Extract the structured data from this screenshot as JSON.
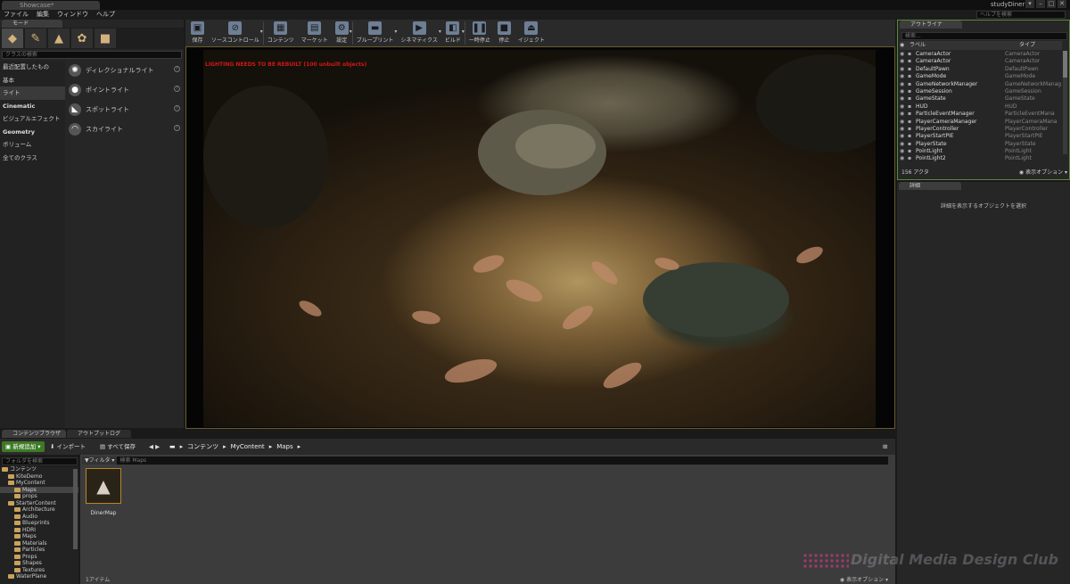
{
  "app": {
    "doc_tab": "Showcase*",
    "project_name": "studyDiner",
    "help_search_placeholder": "ヘルプを検索",
    "window_controls": [
      "▾",
      "–",
      "□",
      "✕"
    ]
  },
  "menu": [
    "ファイル",
    "編集",
    "ウィンドウ",
    "ヘルプ"
  ],
  "modes": {
    "tab": "モード",
    "icons": [
      "place-icon",
      "paint-icon",
      "landscape-icon",
      "foliage-icon",
      "geometry-icon"
    ],
    "search_placeholder": "クラスの検索",
    "categories": [
      {
        "label": "最近配置したもの",
        "selected": false,
        "head": false
      },
      {
        "label": "基本",
        "selected": false,
        "head": false
      },
      {
        "label": "ライト",
        "selected": true,
        "head": false
      },
      {
        "label": "Cinematic",
        "selected": false,
        "head": true
      },
      {
        "label": "ビジュアルエフェクト",
        "selected": false,
        "head": false
      },
      {
        "label": "Geometry",
        "selected": false,
        "head": true
      },
      {
        "label": "ボリューム",
        "selected": false,
        "head": false
      },
      {
        "label": "全てのクラス",
        "selected": false,
        "head": false
      }
    ],
    "items": [
      {
        "label": "ディレクショナルライト",
        "icon": "directional-light-icon",
        "glyph": "✺"
      },
      {
        "label": "ポイントライト",
        "icon": "point-light-icon",
        "glyph": "●"
      },
      {
        "label": "スポットライト",
        "icon": "spot-light-icon",
        "glyph": "◣"
      },
      {
        "label": "スカイライト",
        "icon": "sky-light-icon",
        "glyph": "◠"
      }
    ]
  },
  "toolbar": {
    "buttons": [
      {
        "label": "保存",
        "icon": "save-icon",
        "glyph": "▣",
        "dropdown": false
      },
      {
        "label": "ソースコントロール",
        "icon": "source-control-icon",
        "glyph": "⊘",
        "dropdown": true
      },
      {
        "label": "コンテンツ",
        "icon": "content-icon",
        "glyph": "▦",
        "dropdown": false
      },
      {
        "label": "マーケット",
        "icon": "marketplace-icon",
        "glyph": "▤",
        "dropdown": false
      },
      {
        "label": "設定",
        "icon": "settings-icon",
        "glyph": "⚙",
        "dropdown": true
      },
      {
        "label": "ブループリント",
        "icon": "blueprint-icon",
        "glyph": "▬",
        "dropdown": true
      },
      {
        "label": "シネマティクス",
        "icon": "cinematics-icon",
        "glyph": "▶",
        "dropdown": true
      },
      {
        "label": "ビルド",
        "icon": "build-icon",
        "glyph": "◧",
        "dropdown": true
      },
      {
        "label": "一時停止",
        "icon": "pause-icon",
        "glyph": "❚❚",
        "dropdown": false
      },
      {
        "label": "停止",
        "icon": "stop-icon",
        "glyph": "■",
        "dropdown": false
      },
      {
        "label": "イジェクト",
        "icon": "eject-icon",
        "glyph": "⏏",
        "dropdown": false
      }
    ]
  },
  "viewport": {
    "warning": "LIGHTING NEEDS TO BE REBUILT (100 unbuilt objects)"
  },
  "outliner": {
    "tab": "アウトライナ",
    "search_placeholder": "検索...",
    "col_label": "ラベル",
    "col_type": "タイプ",
    "rows": [
      {
        "name": "CameraActor",
        "type": "CameraActor"
      },
      {
        "name": "CameraActor",
        "type": "CameraActor"
      },
      {
        "name": "DefaultPawn",
        "type": "DefaultPawn"
      },
      {
        "name": "GameMode",
        "type": "GameMode"
      },
      {
        "name": "GameNetworkManager",
        "type": "GameNetworkManag"
      },
      {
        "name": "GameSession",
        "type": "GameSession"
      },
      {
        "name": "GameState",
        "type": "GameState"
      },
      {
        "name": "HUD",
        "type": "HUD"
      },
      {
        "name": "ParticleEventManager",
        "type": "ParticleEventMana"
      },
      {
        "name": "PlayerCameraManager",
        "type": "PlayerCameraMana"
      },
      {
        "name": "PlayerController",
        "type": "PlayerController"
      },
      {
        "name": "PlayerStartPIE",
        "type": "PlayerStartPIE"
      },
      {
        "name": "PlayerState",
        "type": "PlayerState"
      },
      {
        "name": "PointLight",
        "type": "PointLight"
      },
      {
        "name": "PointLight2",
        "type": "PointLight"
      }
    ],
    "actor_count": "156 アクタ",
    "view_options": "表示オプション"
  },
  "details": {
    "tab": "詳細",
    "message": "詳細を表示するオブジェクトを選択"
  },
  "content_browser": {
    "tabs": [
      "コンテンツブラウザ",
      "アウトプットログ"
    ],
    "add_new": "新規追加",
    "import": "インポート",
    "save_all": "すべて保存",
    "breadcrumb": [
      "コンテンツ",
      "MyContent",
      "Maps"
    ],
    "folder_search_placeholder": "フォルダを検索",
    "filter_label": "フィルタ",
    "asset_search_placeholder": "検索 Maps",
    "tree": [
      {
        "label": "コンテンツ",
        "indent": 0,
        "selected": false
      },
      {
        "label": "KiteDemo",
        "indent": 1,
        "selected": false
      },
      {
        "label": "MyContent",
        "indent": 1,
        "selected": false
      },
      {
        "label": "Maps",
        "indent": 2,
        "selected": true
      },
      {
        "label": "props",
        "indent": 2,
        "selected": false
      },
      {
        "label": "StarterContent",
        "indent": 1,
        "selected": false
      },
      {
        "label": "Architecture",
        "indent": 2,
        "selected": false
      },
      {
        "label": "Audio",
        "indent": 2,
        "selected": false
      },
      {
        "label": "Blueprints",
        "indent": 2,
        "selected": false
      },
      {
        "label": "HDRI",
        "indent": 2,
        "selected": false
      },
      {
        "label": "Maps",
        "indent": 2,
        "selected": false
      },
      {
        "label": "Materials",
        "indent": 2,
        "selected": false
      },
      {
        "label": "Particles",
        "indent": 2,
        "selected": false
      },
      {
        "label": "Props",
        "indent": 2,
        "selected": false
      },
      {
        "label": "Shapes",
        "indent": 2,
        "selected": false
      },
      {
        "label": "Textures",
        "indent": 2,
        "selected": false
      },
      {
        "label": "WaterPlane",
        "indent": 1,
        "selected": false
      }
    ],
    "asset": {
      "label": "DinerMap",
      "icon": "map-asset-icon"
    },
    "item_count": "1アイテム",
    "view_options": "表示オプション"
  },
  "watermark": "Digital Media Design Club"
}
